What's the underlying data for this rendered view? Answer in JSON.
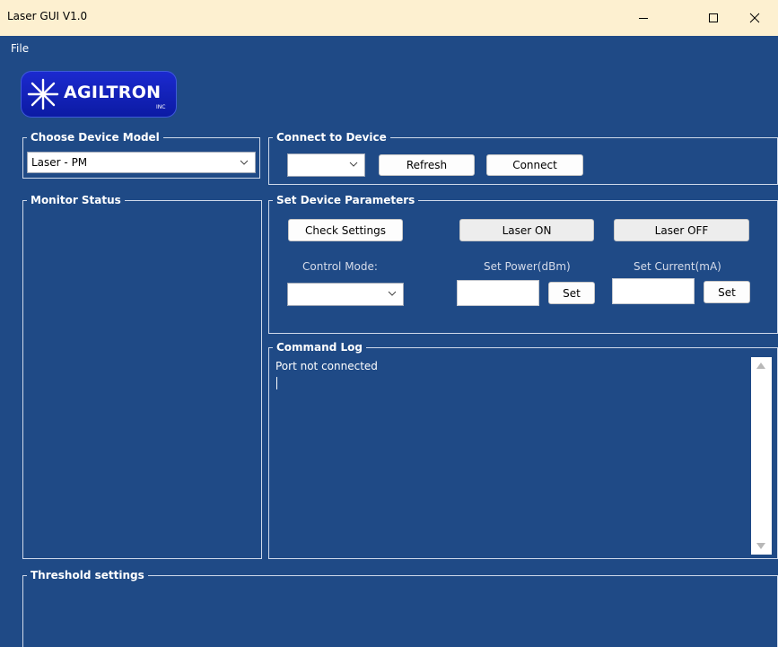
{
  "window": {
    "title": "Laser GUI V1.0",
    "minimize_glyph": "—",
    "maximize_glyph": "☐",
    "close_glyph": "✕"
  },
  "menu": {
    "file": "File"
  },
  "logo": {
    "brand": "AGILTRON",
    "suffix": "INC"
  },
  "choose_device": {
    "legend": "Choose Device Model",
    "selected": "Laser - PM"
  },
  "connect": {
    "legend": "Connect to Device",
    "port_selected": "",
    "refresh_label": "Refresh",
    "connect_label": "Connect"
  },
  "monitor": {
    "legend": "Monitor Status"
  },
  "params": {
    "legend": "Set Device Parameters",
    "check_settings_label": "Check Settings",
    "laser_on_label": "Laser ON",
    "laser_off_label": "Laser OFF",
    "control_mode_label": "Control Mode:",
    "control_mode_selected": "",
    "set_power_label": "Set Power(dBm)",
    "set_power_value": "",
    "set_power_button": "Set",
    "set_current_label": "Set Current(mA)",
    "set_current_value": "",
    "set_current_button": "Set"
  },
  "command_log": {
    "legend": "Command Log",
    "text": "Port not connected"
  },
  "threshold": {
    "legend": "Threshold settings"
  },
  "colors": {
    "background": "#1f4a86",
    "titlebar": "#fdf0d0",
    "logo_blue": "#1c2ad0"
  }
}
